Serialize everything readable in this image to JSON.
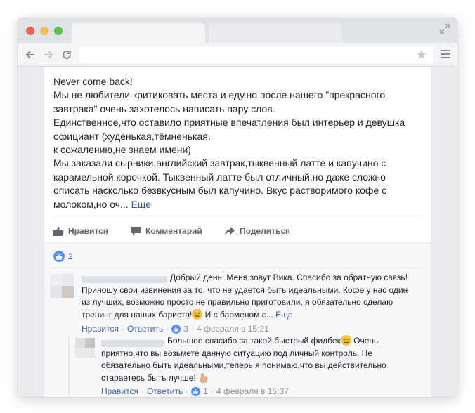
{
  "post": {
    "lines": [
      "Never come back!",
      "Мы не любители критиковать места и еду,но после нашего \"прекрасного",
      "завтрака\" очень захотелось написать пару слов.",
      "Единственное,что оставило приятные впечатления был интерьер и девушка",
      "официант (худенькая,тёмненькая.",
      "к сожалению,не знаем имени)",
      "Мы заказали сырники,английский завтрак,тыквенный латте и капучино с",
      "карамельной корочкой. Тыквенный латте был отличный,но даже сложно",
      "описать насколько безвкусным был капучино. Вкус растворимого кофе с"
    ],
    "last_line": "молоком,но оч...",
    "more_link": "Еще"
  },
  "actions": {
    "like": "Нравится",
    "comment": "Комментарий",
    "share": "Поделиться"
  },
  "reactions": {
    "count": "2"
  },
  "comments": [
    {
      "lines": [
        "Добрый день! Меня зовут Вика. Спасибо за обратную связь!",
        "Приношу свои извинения за то, что не удается быть идеальными. Кофе у нас один",
        "из лучших, возможно просто не правильно приготовили, я обязательно сделаю"
      ],
      "last_before": "тренинг для наших бариста!",
      "last_after": " И с барменом с...",
      "more_link": "Еще",
      "meta": {
        "like": "Нравится",
        "reply": "Ответить",
        "likes": "3",
        "time": "4 февраля в 15:21",
        "dot": "·"
      }
    },
    {
      "first_line": "Большое спасибо за такой быстрый фидбек",
      "first_after": " Очень",
      "lines": [
        "приятно,что вы возьмете данную ситуацию под личный контроль. Не",
        "обязательно быть идеальными,теперь я понимаю,что вы действительно"
      ],
      "last_line": "стараетесь быть лучше!",
      "meta": {
        "like": "Нравится",
        "reply": "Ответить",
        "likes": "1",
        "time": "4 февраля в 15:37",
        "dot": "·"
      }
    }
  ],
  "icons": {
    "back": "arrow-left-icon",
    "forward": "arrow-right-icon",
    "reload": "reload-icon",
    "bookmark": "star-icon",
    "menu": "hamburger-menu-icon",
    "expand": "expand-icon",
    "like": "thumbs-up-icon",
    "comment": "comment-bubble-icon",
    "share": "share-arrow-icon",
    "sad": "sad-face-emoji",
    "smile": "smiling-face-emoji",
    "hand": "pointing-hand-emoji"
  },
  "colors": {
    "link": "#365899",
    "accent": "#5890ff",
    "muted": "#90949c",
    "text": "#1d2129"
  }
}
